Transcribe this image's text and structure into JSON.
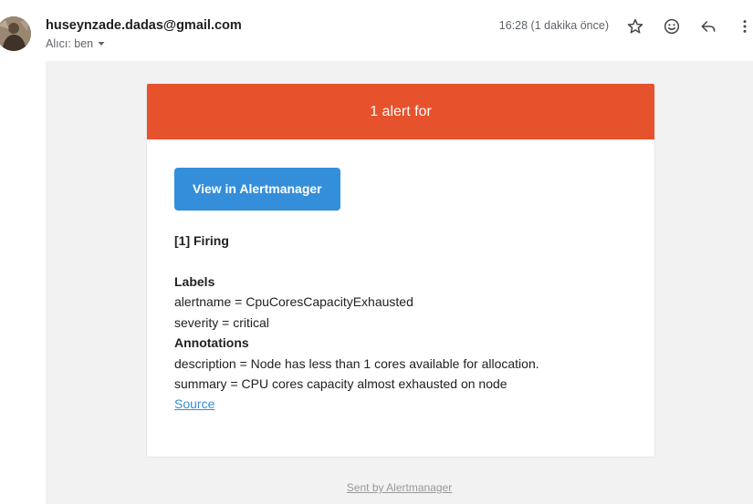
{
  "header": {
    "sender": "huseynzade.dadas@gmail.com",
    "recipient_line": "Alıcı: ben",
    "timestamp": "16:28 (1 dakika önce)",
    "icons": [
      "avatar",
      "chevron-down-icon",
      "star-icon",
      "emoji-icon",
      "reply-icon",
      "more-vert-icon"
    ]
  },
  "email": {
    "banner_text": "1 alert for",
    "button_label": "View in Alertmanager",
    "firing_heading": "[1] Firing",
    "labels_heading": "Labels",
    "labels": [
      "alertname = CpuCoresCapacityExhausted",
      "severity = critical"
    ],
    "annotations_heading": "Annotations",
    "annotations": [
      "description = Node has less than 1 cores available for allocation.",
      "summary = CPU cores capacity almost exhausted on node"
    ],
    "source_link": "Source",
    "footer": "Sent by Alertmanager"
  },
  "colors": {
    "banner": "#e6522c",
    "button": "#348eda",
    "mail_background": "#f2f2f2",
    "link": "#348eda"
  }
}
